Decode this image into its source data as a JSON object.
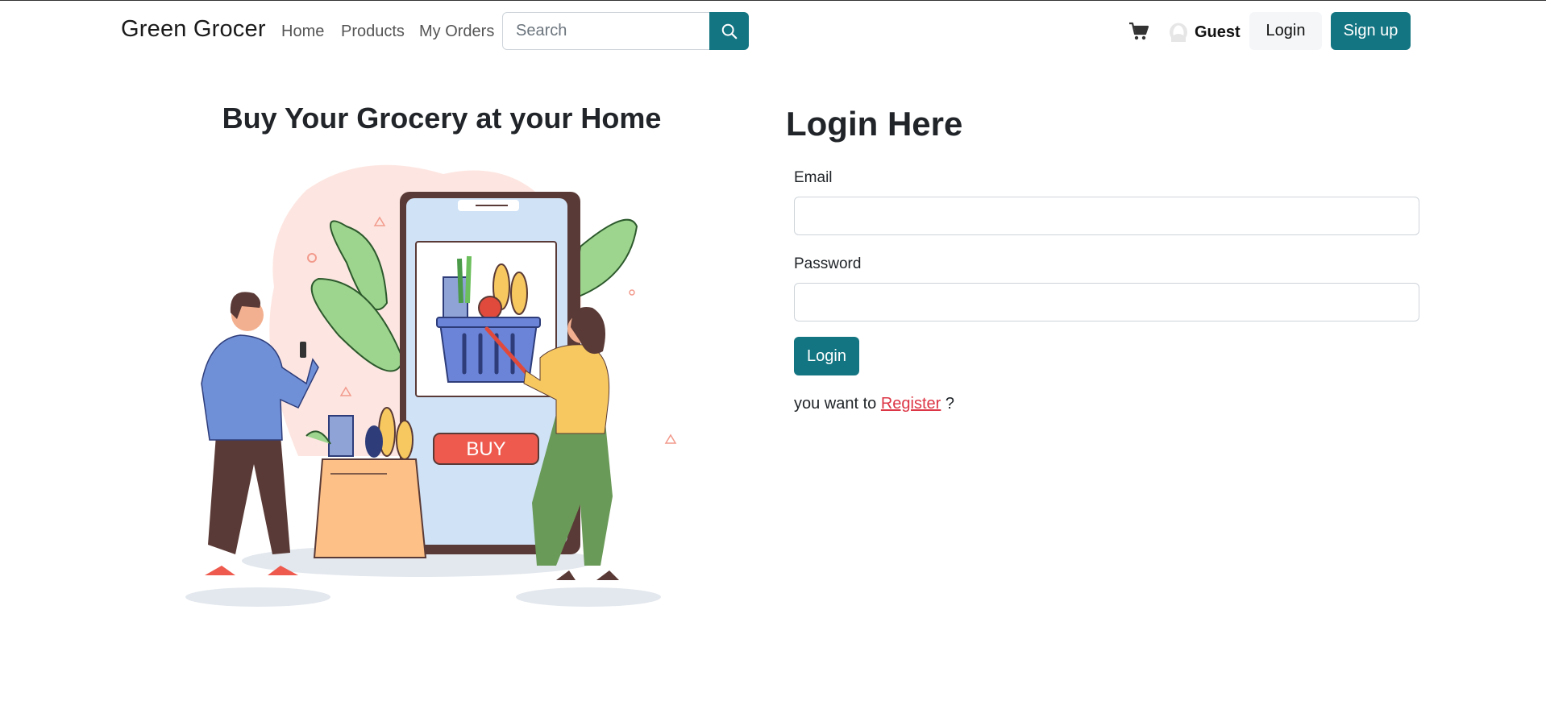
{
  "navbar": {
    "brand": "Green Grocer",
    "links": [
      "Home",
      "Products",
      "My Orders"
    ],
    "search_placeholder": "Search",
    "user_name": "Guest",
    "login_label": "Login",
    "signup_label": "Sign up",
    "icons": {
      "search": "search-icon",
      "cart": "cart-icon",
      "user": "user-avatar-icon"
    }
  },
  "hero": {
    "title": "Buy Your Grocery at your Home",
    "phone_button": "BUY"
  },
  "login_form": {
    "title": "Login Here",
    "email_label": "Email",
    "email_value": "",
    "password_label": "Password",
    "password_value": "",
    "submit_label": "Login",
    "register_prefix": "you want to",
    "register_link": "Register",
    "register_suffix": "?"
  },
  "colors": {
    "primary": "#147582",
    "link_danger": "#dc3545",
    "text": "#212529"
  }
}
